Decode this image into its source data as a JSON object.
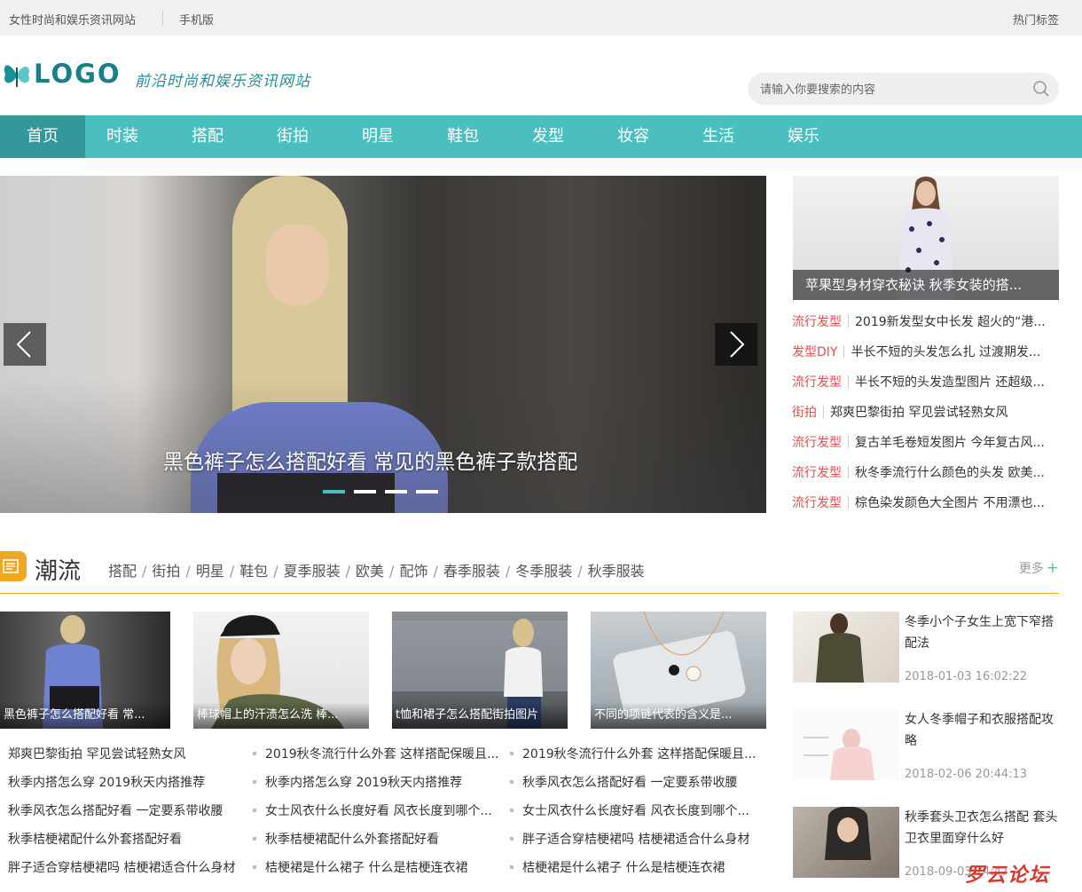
{
  "topbar": {
    "site_desc": "女性时尚和娱乐资讯网站",
    "mobile": "手机版",
    "hot_tags": "热门标签"
  },
  "header": {
    "logo_text": "LOGO",
    "slogan": "前沿时尚和娱乐资讯网站",
    "search_placeholder": "请输入你要搜索的内容"
  },
  "nav": [
    "首页",
    "时装",
    "搭配",
    "街拍",
    "明星",
    "鞋包",
    "发型",
    "妆容",
    "生活",
    "娱乐"
  ],
  "hero": {
    "caption": "黑色裤子怎么搭配好看 常见的黑色裤子款搭配",
    "active_dot": 1,
    "dot_count": 4
  },
  "feature": {
    "caption": "苹果型身材穿衣秘诀 秋季女装的搭..."
  },
  "right_list": [
    {
      "cat": "流行发型",
      "title": "2019新发型女中长发 超火的“港..."
    },
    {
      "cat": "发型DIY",
      "title": "半长不短的头发怎么扎 过渡期发..."
    },
    {
      "cat": "流行发型",
      "title": "半长不短的头发造型图片 还超级..."
    },
    {
      "cat": "街拍",
      "title": "郑爽巴黎街拍 罕见尝试轻熟女风"
    },
    {
      "cat": "流行发型",
      "title": "复古羊毛卷短发图片 今年复古风..."
    },
    {
      "cat": "流行发型",
      "title": "秋冬季流行什么颜色的头发 欧美..."
    },
    {
      "cat": "流行发型",
      "title": "棕色染发颜色大全图片 不用漂也..."
    }
  ],
  "section": {
    "title": "潮流",
    "tags": [
      "搭配",
      "街拍",
      "明星",
      "鞋包",
      "夏季服装",
      "欧美",
      "配饰",
      "春季服装",
      "冬季服装",
      "秋季服装"
    ],
    "more": "更多",
    "more_plus": "+"
  },
  "thumbs": [
    {
      "caption": "黑色裤子怎么搭配好看 常..."
    },
    {
      "caption": "棒球帽上的汗渍怎么洗 棒..."
    },
    {
      "caption": "t恤和裙子怎么搭配街拍图片"
    },
    {
      "caption": "不同的项链代表的含义是..."
    }
  ],
  "lists": [
    [
      "郑爽巴黎街拍 罕见尝试轻熟女风",
      "秋季内搭怎么穿 2019秋天内搭推荐",
      "秋季风衣怎么搭配好看 一定要系带收腰",
      "秋季桔梗裙配什么外套搭配好看",
      "胖子适合穿桔梗裙吗 桔梗裙适合什么身材"
    ],
    [
      "2019秋冬流行什么外套 这样搭配保暖且...",
      "秋季内搭怎么穿 2019秋天内搭推荐",
      "女士风衣什么长度好看 风衣长度到哪个...",
      "秋季桔梗裙配什么外套搭配好看",
      "桔梗裙是什么裙子 什么是桔梗连衣裙"
    ],
    [
      "2019秋冬流行什么外套 这样搭配保暖且...",
      "秋季风衣怎么搭配好看 一定要系带收腰",
      "女士风衣什么长度好看 风衣长度到哪个...",
      "胖子适合穿桔梗裙吗 桔梗裙适合什么身材",
      "桔梗裙是什么裙子 什么是桔梗连衣裙"
    ]
  ],
  "news": [
    {
      "title": "冬季小个子女生上宽下窄搭配法",
      "date": "2018-01-03 16:02:22"
    },
    {
      "title": "女人冬季帽子和衣服搭配攻略",
      "date": "2018-02-06 20:44:13"
    },
    {
      "title": "秋季套头卫衣怎么搭配 套头卫衣里面穿什么好",
      "date": "2018-09-03 14:47"
    }
  ],
  "watermark": "罗云论坛",
  "colors": {
    "accent": "#4bbfbf",
    "nav_active": "#34979a",
    "section": "#f4a623",
    "category": "#e05050"
  }
}
